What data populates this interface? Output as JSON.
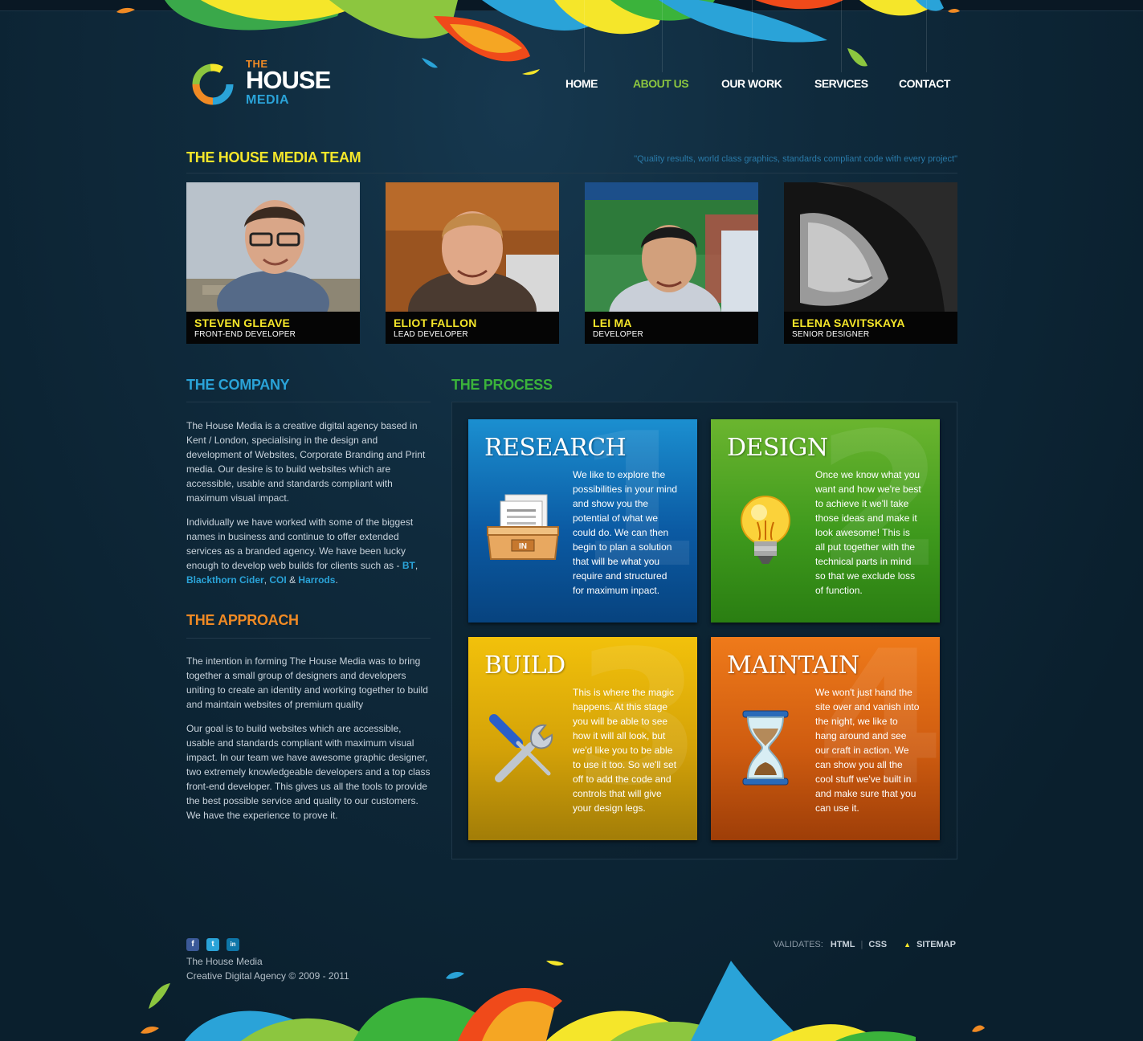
{
  "logo": {
    "the": "THE",
    "house": "HOUSE",
    "media": "MEDIA"
  },
  "nav": [
    {
      "label": "HOME"
    },
    {
      "label": "ABOUT US"
    },
    {
      "label": "OUR WORK"
    },
    {
      "label": "SERVICES"
    },
    {
      "label": "CONTACT"
    }
  ],
  "team": {
    "title": "THE HOUSE MEDIA TEAM",
    "quote": "\"Quality results, world class graphics, standards compliant code with every project\"",
    "members": [
      {
        "name": "STEVEN GLEAVE",
        "role": "FRONT-END DEVELOPER"
      },
      {
        "name": "ELIOT FALLON",
        "role": "LEAD DEVELOPER"
      },
      {
        "name": "LEI MA",
        "role": "DEVELOPER"
      },
      {
        "name": "ELENA  SAVITSKAYA",
        "role": "SENIOR DESIGNER"
      }
    ]
  },
  "company": {
    "title": "THE COMPANY",
    "p1": "The House Media is a creative digital agency based in Kent / London, specialising in the design and development of Websites, Corporate Branding and Print media. Our desire is to build websites which are accessible, usable and standards compliant with maximum visual impact.",
    "p2_before": "Individually we have worked with some of the biggest names in business and continue to offer extended services as a branded agency. We have been lucky enough to develop web builds for clients such as - ",
    "client_bt": "BT",
    "client_blackthorn": "Blackthorn Cider",
    "client_coi": "COI",
    "client_harrods": "Harrods",
    "comma": ",",
    "amp": "&",
    "period": "."
  },
  "approach": {
    "title": "THE APPROACH",
    "p1": "The intention in forming The House Media was to bring together a small group of designers and developers uniting to create an identity and working together to build and maintain websites of premium quality",
    "p2": "Our goal is to build websites which are accessible, usable and standards compliant with maximum visual impact. In our team we have awesome graphic designer, two extremely knowledgeable developers and a top class front-end developer. This gives us all the tools to provide the best possible service and quality to our customers. We have the experience to prove it."
  },
  "process": {
    "title": "THE PROCESS",
    "steps": [
      {
        "num": "1",
        "title": "RESEARCH",
        "text": "We like to explore the possibilities in your mind and show you the potential of what we could do. We can then begin to plan a solution that will be what you require and structured for maximum inpact."
      },
      {
        "num": "2",
        "title": "DESIGN",
        "text": "Once we know what you want and how we're best to achieve it we'll take those ideas and make it look awesome! This is all put together with the technical parts in mind so that we exclude loss of function."
      },
      {
        "num": "3",
        "title": "BUILD",
        "text": "This is where the magic happens. At this stage you will be able to see how it will all look, but we'd like you to be able to use it too. So we'll set off to add the code and controls that will give your design legs."
      },
      {
        "num": "4",
        "title": "MAINTAIN",
        "text": "We won't just hand the site over and vanish into the night, we like to hang around and see our craft in action. We can show you all the cool stuff we've built in and make sure that you can use it."
      }
    ],
    "research_icon_label": "IN"
  },
  "footer": {
    "company": "The House Media",
    "tagline": "Creative Digital Agency © 2009 - 2011",
    "validates": "VALIDATES:",
    "html": "HTML",
    "divider": "|",
    "css": "CSS",
    "sitemap": "SITEMAP",
    "social": [
      "f",
      "t",
      "in"
    ]
  },
  "colors": {
    "background": "#0f2a3c",
    "yellow": "#f5e62a",
    "blue": "#2aa3d8",
    "orange": "#f08a24",
    "green": "#3bb33b",
    "nav_active": "#8cc63f"
  }
}
